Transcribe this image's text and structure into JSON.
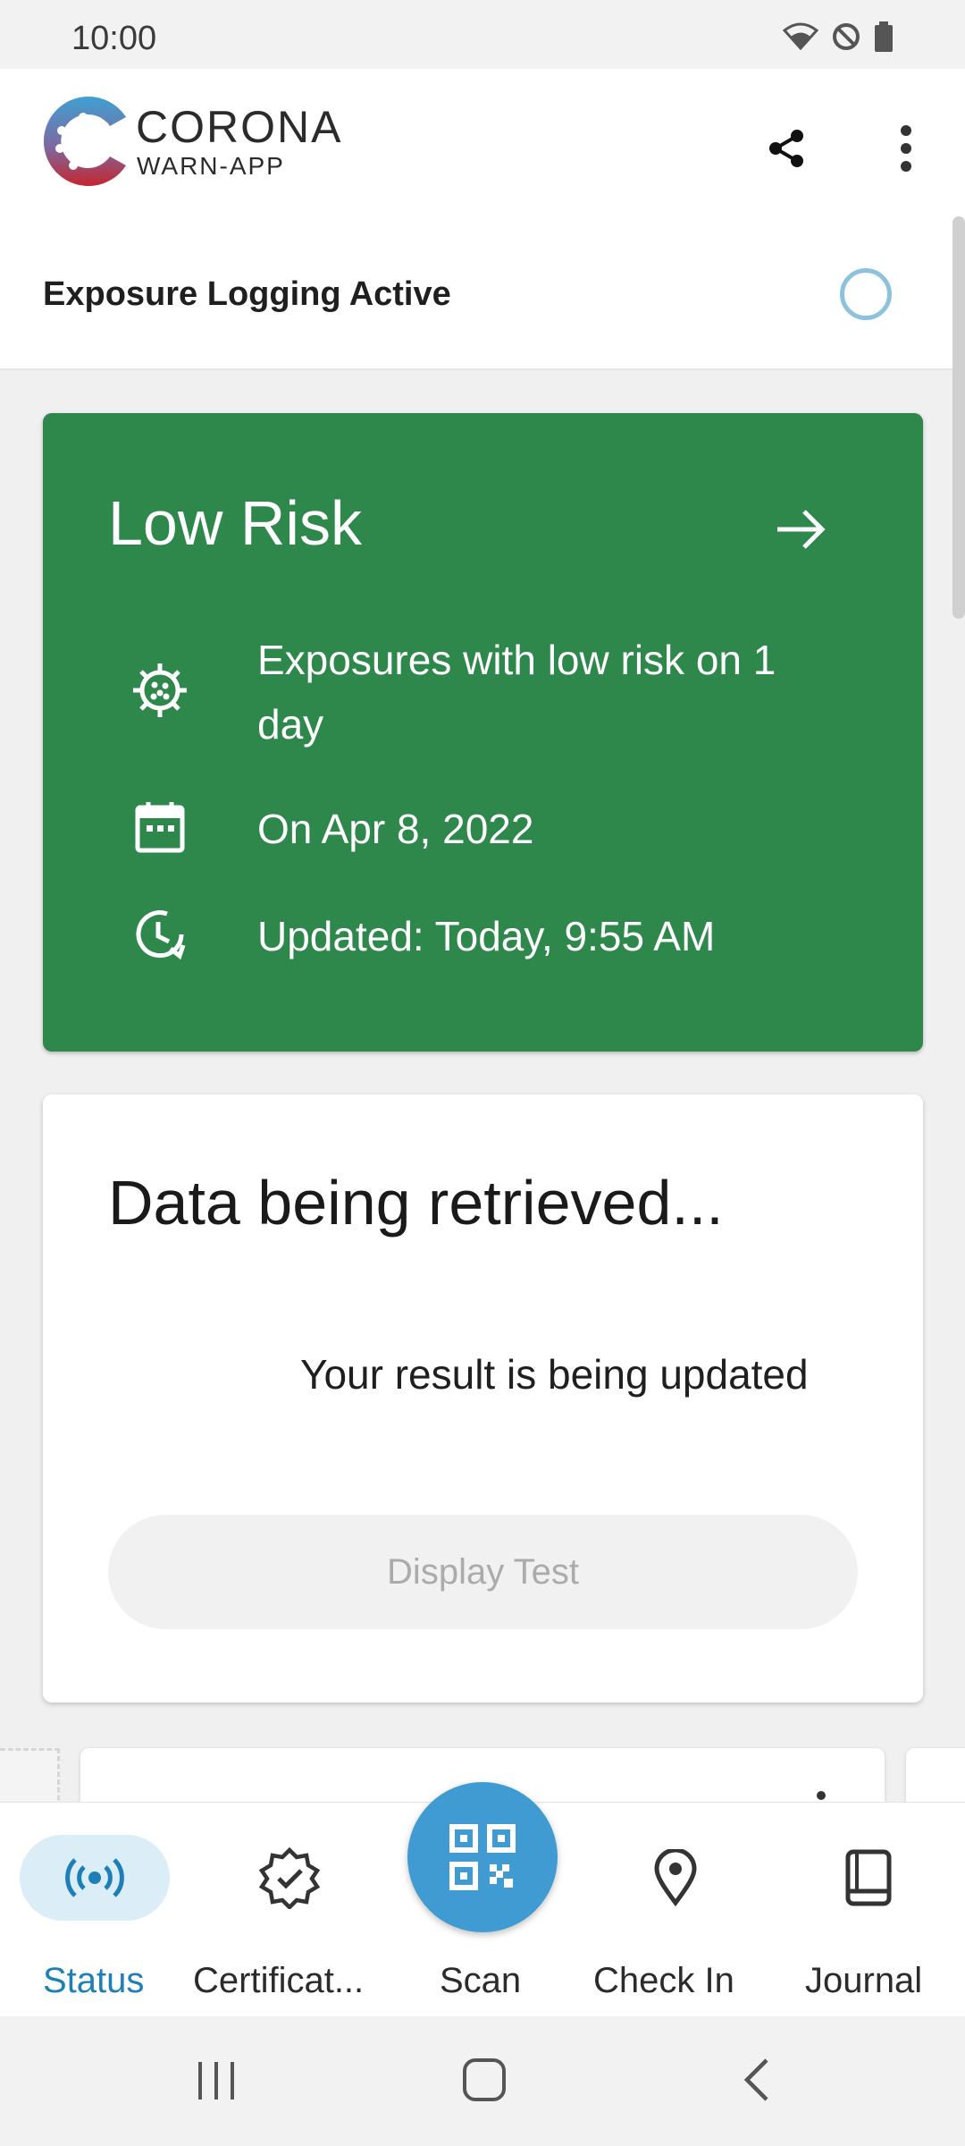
{
  "status_bar": {
    "time": "10:00"
  },
  "app": {
    "title": "CORONA",
    "subtitle": "WARN-APP"
  },
  "exposure_logging": {
    "label": "Exposure Logging Active"
  },
  "risk_card": {
    "title": "Low Risk",
    "color": "#2e874b",
    "rows": [
      {
        "icon": "virus-icon",
        "text_line1": "Exposures with low risk on 1",
        "text_line2": "day"
      },
      {
        "icon": "calendar-icon",
        "text": "On Apr 8, 2022"
      },
      {
        "icon": "history-clock-icon",
        "text": "Updated: Today, 9:55 AM"
      }
    ]
  },
  "data_card": {
    "title": "Data being retrieved...",
    "subtitle": "Your result is being updated",
    "button_label": "Display Test"
  },
  "bottom_nav": {
    "items": [
      {
        "label": "Status",
        "icon": "broadcast-icon",
        "active": true
      },
      {
        "label": "Certificat...",
        "icon": "certificate-badge-icon",
        "active": false
      },
      {
        "label": "Scan",
        "icon": "qr-code-icon",
        "active": false
      },
      {
        "label": "Check In",
        "icon": "location-pin-icon",
        "active": false
      },
      {
        "label": "Journal",
        "icon": "book-icon",
        "active": false
      }
    ],
    "accent": "#1d7fb7",
    "fab_color": "#3f9bd1"
  }
}
